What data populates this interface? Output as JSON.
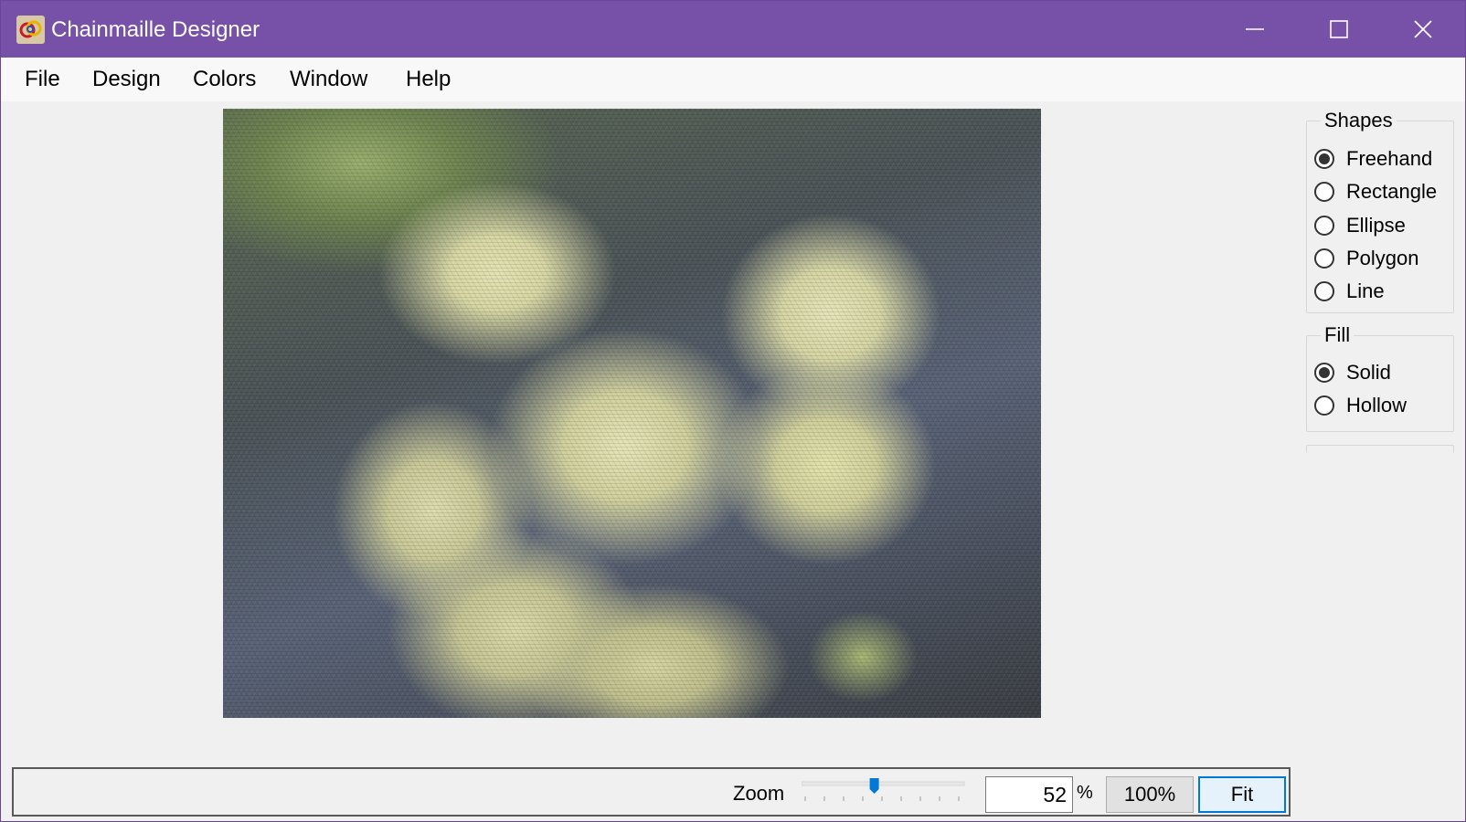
{
  "window": {
    "title": "Chainmaille Designer",
    "accent_color": "#7750a8",
    "icons": {
      "minimize": "minimize-icon",
      "maximize": "maximize-icon",
      "close": "close-icon",
      "app": "chainmaille-rings-icon"
    }
  },
  "menu": {
    "items": [
      {
        "label": "File"
      },
      {
        "label": "Design"
      },
      {
        "label": "Colors"
      },
      {
        "label": "Window"
      },
      {
        "label": "Help"
      }
    ]
  },
  "canvas": {
    "content": "chainmaille-rendered-image"
  },
  "shapes": {
    "legend": "Shapes",
    "selected": "Freehand",
    "options": [
      {
        "label": "Freehand",
        "checked": true
      },
      {
        "label": "Rectangle",
        "checked": false
      },
      {
        "label": "Ellipse",
        "checked": false
      },
      {
        "label": "Polygon",
        "checked": false
      },
      {
        "label": "Line",
        "checked": false
      }
    ]
  },
  "fill": {
    "legend": "Fill",
    "selected": "Solid",
    "options": [
      {
        "label": "Solid",
        "checked": true
      },
      {
        "label": "Hollow",
        "checked": false
      }
    ]
  },
  "zoom": {
    "label": "Zoom",
    "value": "52",
    "unit": "%",
    "slider_fraction": 0.45,
    "btn_100_label": "100%",
    "btn_fit_label": "Fit"
  }
}
